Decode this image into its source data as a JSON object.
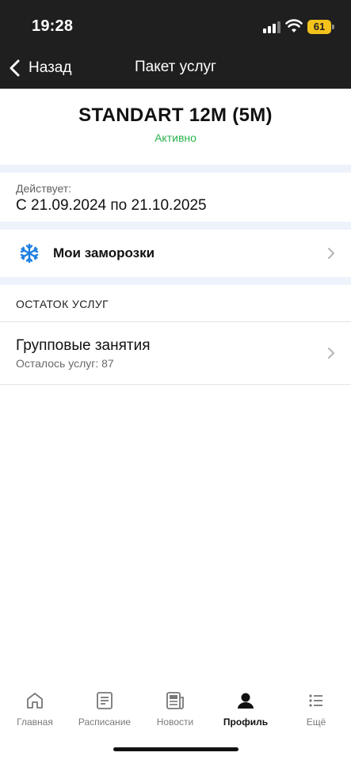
{
  "status_bar": {
    "time": "19:28",
    "battery_level": "61",
    "battery_color": "#f3c31c",
    "icons": [
      "signal-icon",
      "wifi-icon",
      "battery-icon"
    ]
  },
  "nav": {
    "back_label": "Назад",
    "title": "Пакет услуг"
  },
  "plan": {
    "title": "STANDART 12M (5M)",
    "status": "Активно",
    "status_color": "#2bb24c"
  },
  "period": {
    "label": "Действует:",
    "value": "С 21.09.2024 по 21.10.2025"
  },
  "freeze": {
    "label": "Мои заморозки",
    "icon": "snowflake-icon"
  },
  "services_section": {
    "title": "ОСТАТОК УСЛУГ",
    "items": [
      {
        "name": "Групповые занятия",
        "remaining": "Осталось услуг: 87"
      }
    ]
  },
  "tab_bar": {
    "active": "Профиль",
    "tabs": [
      {
        "label": "Главная",
        "icon": "home-icon"
      },
      {
        "label": "Расписание",
        "icon": "schedule-icon"
      },
      {
        "label": "Новости",
        "icon": "news-icon"
      },
      {
        "label": "Профиль",
        "icon": "profile-icon"
      },
      {
        "label": "Ещё",
        "icon": "more-icon"
      }
    ]
  }
}
